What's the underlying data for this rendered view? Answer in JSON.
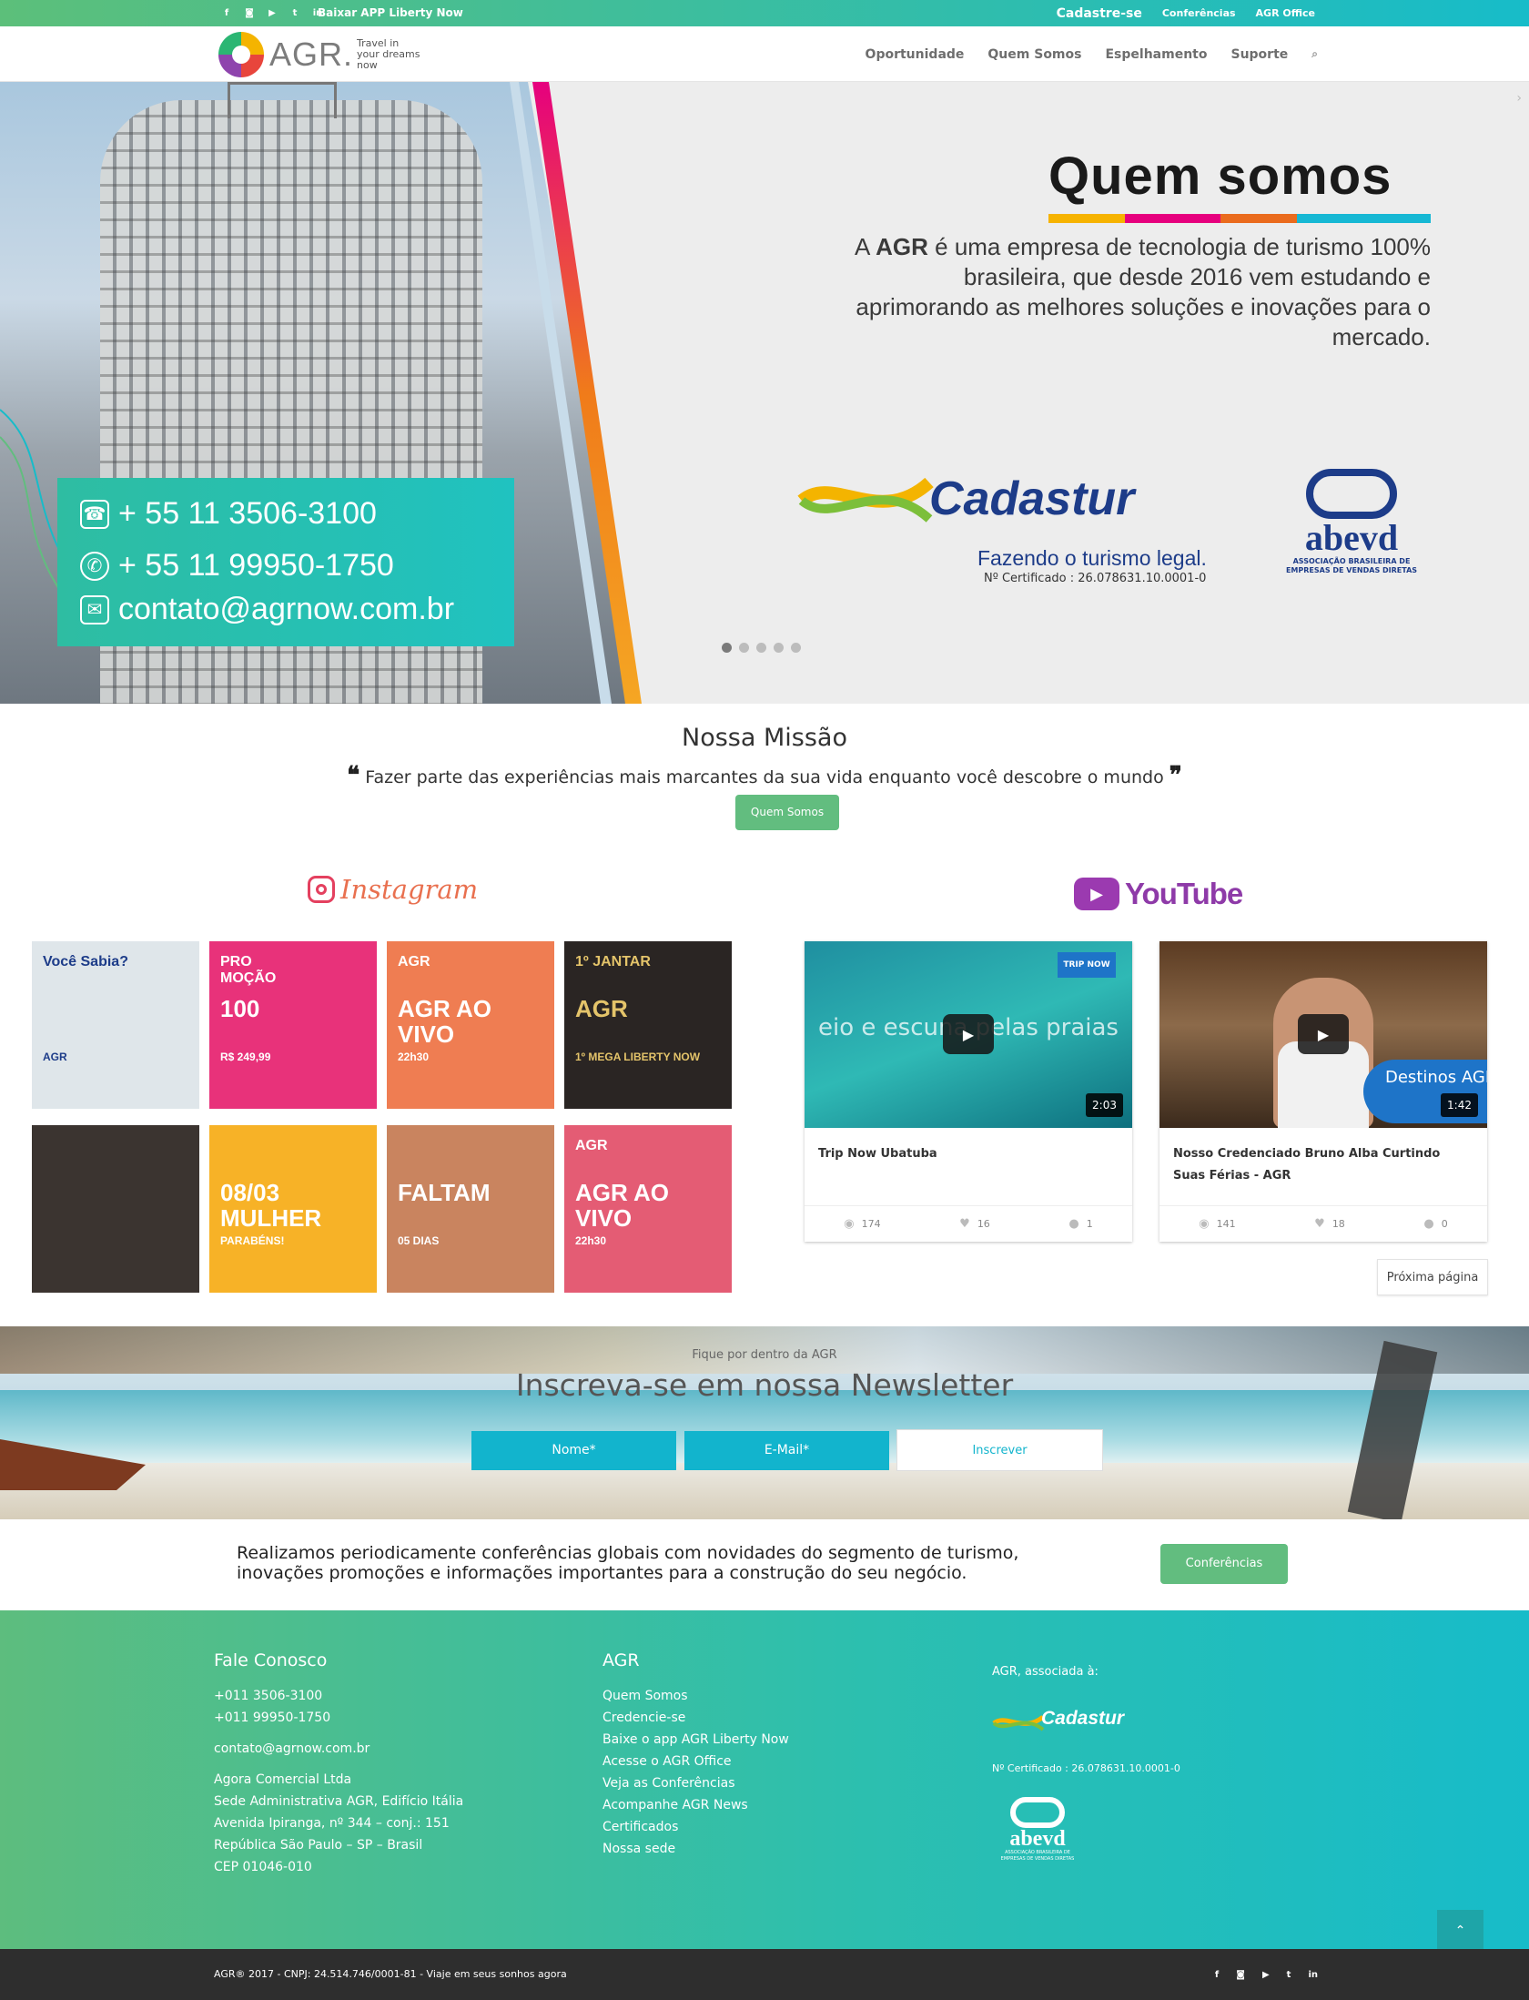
{
  "topbar": {
    "social_icons": [
      "facebook-icon",
      "instagram-icon",
      "youtube-icon",
      "twitter-icon",
      "linkedin-icon"
    ],
    "social_glyphs": [
      "f",
      "◙",
      "▶",
      "t",
      "in"
    ],
    "app_link": "Baixar APP Liberty Now",
    "cadastre": "Cadastre-se",
    "conferencias": "Conferências",
    "office": "AGR Office"
  },
  "header": {
    "logo_word": "AGR.",
    "logo_tagline": "Travel in your dreams now",
    "nav": [
      "Oportunidade",
      "Quem Somos",
      "Espelhamento",
      "Suporte"
    ],
    "search_glyph": "⌕"
  },
  "hero": {
    "phone1": "+ 55 11 3506-3100",
    "phone2": "+ 55 11 99950-1750",
    "email": "contato@agrnow.com.br",
    "title": "Quem somos",
    "text_prefix": "A ",
    "text_brand": "AGR",
    "text_rest": " é uma empresa de tecnologia de turismo 100% brasileira, que desde 2016 vem estudando e aprimorando as melhores soluções e inovações para o mercado.",
    "cadastur_name": "Cadastur",
    "cadastur_slogan": "Fazendo o turismo legal.",
    "cadastur_cert": "Nº Certificado : 26.078631.10.0001-0",
    "abevd_name": "abevd",
    "abevd_sub": "ASSOCIAÇÃO BRASILEIRA DE EMPRESAS DE VENDAS DIRETAS",
    "slides_total": 5,
    "slide_active": 1,
    "edge_glyph": "›"
  },
  "mission": {
    "title": "Nossa Missão",
    "open_quote": "❝",
    "quote": " Fazer parte das experiências mais marcantes da sua vida enquanto você descobre o mundo ",
    "close_quote": "❞",
    "button": "Quem Somos"
  },
  "instagram": {
    "title": "Instagram",
    "tiles": [
      {
        "t1": "Você Sabia?",
        "t2": "",
        "t3": "AGR",
        "bg": "#dfe6ea",
        "fg": "#1d3c89"
      },
      {
        "t1": "PRO\nMOÇÃO",
        "t2": "100",
        "t3": "R$ 249,99",
        "bg": "#e8327a",
        "fg": "#fff"
      },
      {
        "t1": "AGR",
        "t2": "AGR AO VIVO",
        "t3": "22h30",
        "bg": "#ef7d52",
        "fg": "#fff"
      },
      {
        "t1": "1º JANTAR",
        "t2": "AGR",
        "t3": "1º MEGA LIBERTY NOW",
        "bg": "#2a2523",
        "fg": "#e4c46a"
      },
      {
        "t1": "",
        "t2": "",
        "t3": "",
        "bg": "#3b3430",
        "fg": "#e4c46a"
      },
      {
        "t1": "",
        "t2": "08/03 MULHER",
        "t3": "PARABÉNS!",
        "bg": "#f7b227",
        "fg": "#fff"
      },
      {
        "t1": "",
        "t2": "FALTAM",
        "t3": "05 DIAS",
        "bg": "#c9845f",
        "fg": "#fff"
      },
      {
        "t1": "AGR",
        "t2": "AGR AO VIVO",
        "t3": "22h30",
        "bg": "#e45c74",
        "fg": "#fff"
      }
    ]
  },
  "youtube": {
    "title": "YouTube",
    "play_glyph": "▶",
    "videos": [
      {
        "title": "Trip Now Ubatuba",
        "duration": "2:03",
        "views": "174",
        "likes": "16",
        "comments": "1",
        "bg": "#2fa9b1",
        "overlay": "eio e escuna pelas praias"
      },
      {
        "title": "Nosso Credenciado Bruno Alba Curtindo Suas Férias - AGR",
        "duration": "1:42",
        "views": "141",
        "likes": "18",
        "comments": "0",
        "bg": "#6b4c32",
        "overlay": "Destinos AGR"
      }
    ],
    "stat_glyphs": [
      "◉",
      "♥",
      "●"
    ],
    "next_page": "Próxima página"
  },
  "newsletter": {
    "eyebrow": "Fique por dentro da AGR",
    "title": "Inscreva-se em nossa Newsletter",
    "name_placeholder": "Nome*",
    "email_placeholder": "E-Mail*",
    "submit": "Inscrever"
  },
  "conference": {
    "text": "Realizamos periodicamente conferências globais com novidades do segmento de turismo, inovações promoções e informações importantes para a construção do seu negócio.",
    "button": "Conferências"
  },
  "footer": {
    "contact_title": "Fale Conosco",
    "phone1": "+011 3506-3100",
    "phone2": "+011 99950-1750",
    "email": "contato@agrnow.com.br",
    "address": [
      "Agora Comercial Ltda",
      "Sede Administrativa AGR, Edifício Itália",
      "Avenida Ipiranga, nº 344 – conj.: 151",
      "República São Paulo – SP – Brasil",
      "CEP 01046-010"
    ],
    "agr_title": "AGR",
    "links": [
      "Quem Somos",
      "Credencie-se",
      "Baixe o app AGR Liberty Now",
      "Acesse o AGR Office",
      "Veja as Conferências",
      "Acompanhe AGR News",
      "Certificados",
      "Nossa sede"
    ],
    "assoc": "AGR, associada à:",
    "cadastur": "Cadastur",
    "cert": "Nº Certificado : 26.078631.10.0001-0",
    "abevd": "abevd",
    "abevd_sub": "ASSOCIAÇÃO BRASILEIRA DE EMPRESAS DE VENDAS DIRETAS",
    "to_top": "⌃"
  },
  "bottombar": {
    "copyright": "AGR® 2017 - CNPJ: 24.514.746/0001-81 - Viaje em seus sonhos agora"
  },
  "colors": {
    "green": "#62bd7f",
    "teal": "#17bcc9",
    "cadastur_blue": "#1d3c89",
    "newsletter_input": "#12b4cd"
  }
}
